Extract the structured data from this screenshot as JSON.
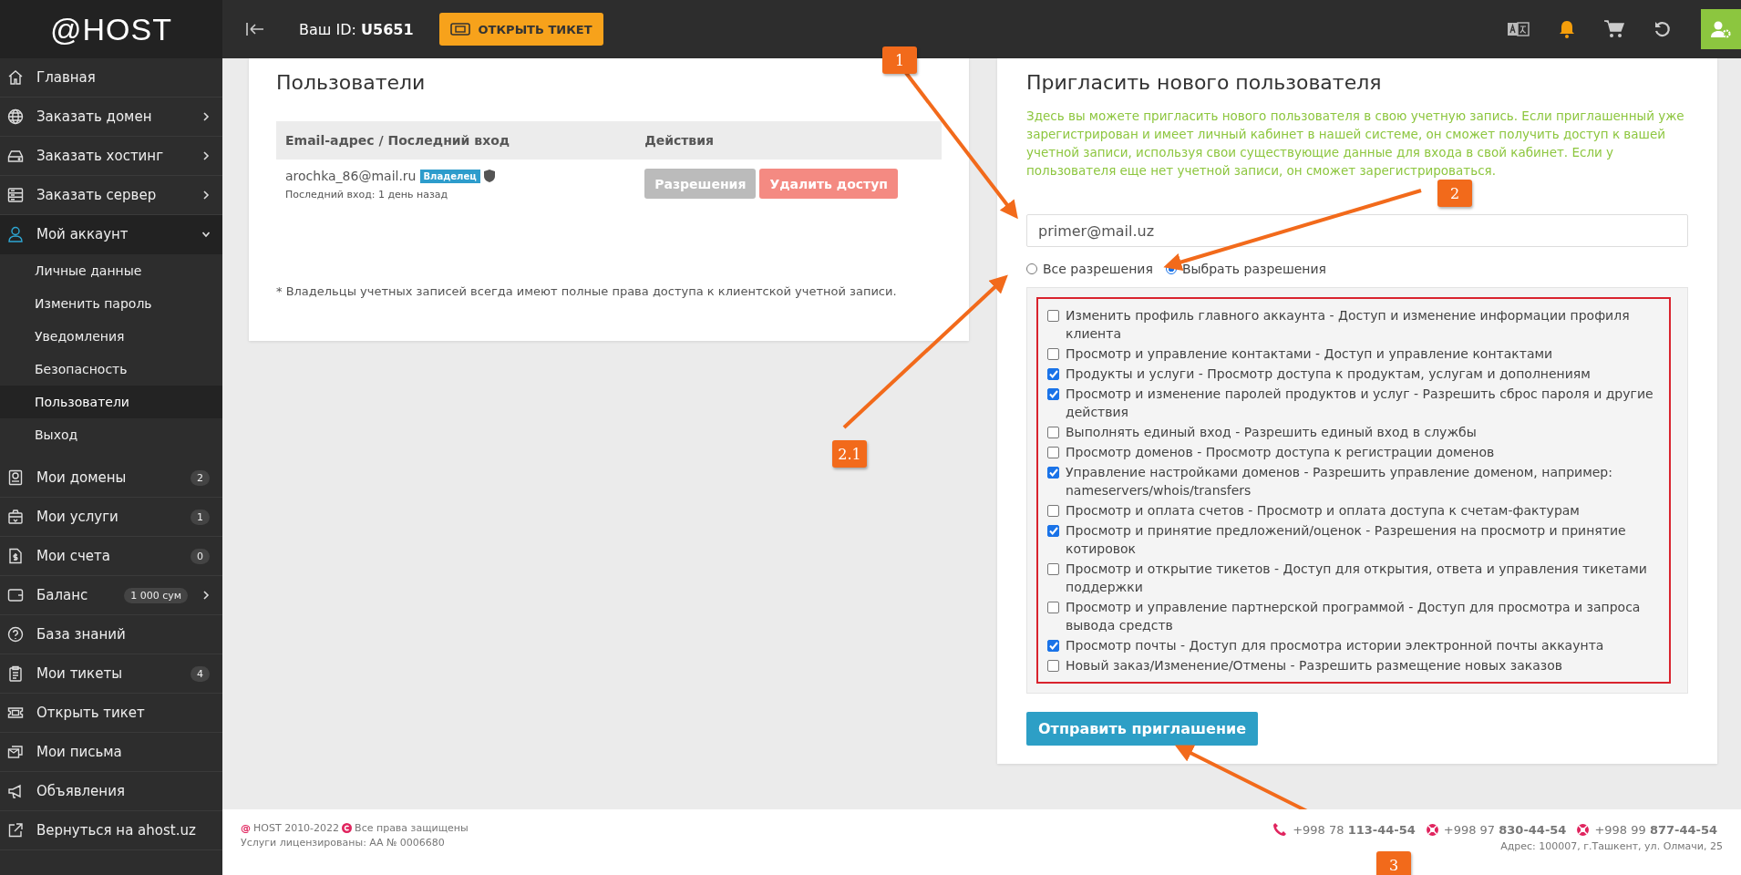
{
  "topbar": {
    "logo": "@HOST",
    "id_label": "Ваш ID:",
    "id_value": "U5651",
    "ticket_button": "ОТКРЫТЬ ТИКЕТ"
  },
  "sidebar": {
    "items": [
      {
        "label": "Главная"
      },
      {
        "label": "Заказать домен",
        "expanded": false
      },
      {
        "label": "Заказать хостинг",
        "expanded": false
      },
      {
        "label": "Заказать сервер",
        "expanded": false
      },
      {
        "label": "Мой аккаунт",
        "expanded": true,
        "children": [
          {
            "label": "Личные данные",
            "selected": false
          },
          {
            "label": "Изменить пароль",
            "selected": false
          },
          {
            "label": "Уведомления",
            "selected": false
          },
          {
            "label": "Безопасность",
            "selected": false
          },
          {
            "label": "Пользователи",
            "selected": true
          },
          {
            "label": "Выход",
            "selected": false
          }
        ]
      },
      {
        "label": "Мои домены",
        "badge": "2"
      },
      {
        "label": "Мои услуги",
        "badge": "1"
      },
      {
        "label": "Мои счета",
        "badge": "0"
      },
      {
        "label": "Баланс",
        "badge": "1 000 сум",
        "expanded": false
      },
      {
        "label": "База знаний"
      },
      {
        "label": "Мои тикеты",
        "badge": "4"
      },
      {
        "label": "Открыть тикет"
      },
      {
        "label": "Мои письма"
      },
      {
        "label": "Объявления"
      },
      {
        "label": "Вернуться на ahost.uz"
      }
    ]
  },
  "users_card": {
    "title": "Пользователи",
    "columns": [
      "Email-адрес / Последний вход",
      "Действия"
    ],
    "rows": [
      {
        "email": "arochka_86@mail.ru",
        "role": "Владелец",
        "last_login": "Последний вход: 1 день назад",
        "actions": [
          "Разрешения",
          "Удалить доступ"
        ]
      }
    ],
    "note": "* Владельцы учетных записей всегда имеют полные права доступа к клиентской учетной записи."
  },
  "invite_card": {
    "title": "Пригласить нового пользователя",
    "description": "Здесь вы можете пригласить нового пользователя в свою учетную запись. Если приглашенный уже зарегистрирован и имеет личный кабинет в нашей системе, он сможет получить доступ к вашей учетной записи, используя свои существующие данные для входа в свой кабинет. Если у пользователя еще нет учетной записи, он сможет зарегистрироваться.",
    "email_placeholder": "primer@mail.uz",
    "scope": [
      {
        "label": "Все разрешения",
        "selected": false
      },
      {
        "label": "Выбрать разрешения",
        "selected": true
      }
    ],
    "permissions": [
      {
        "label": "Изменить профиль главного аккаунта - Доступ и изменение информации профиля клиента",
        "checked": false
      },
      {
        "label": "Просмотр и управление контактами - Доступ и управление контактами",
        "checked": false
      },
      {
        "label": "Продукты и услуги - Просмотр доступа к продуктам, услугам и дополнениям",
        "checked": true
      },
      {
        "label": "Просмотр и изменение паролей продуктов и услуг - Разрешить сброс пароля и другие действия",
        "checked": true
      },
      {
        "label": "Выполнять единый вход - Разрешить единый вход в службы",
        "checked": false
      },
      {
        "label": "Просмотр доменов - Просмотр доступа к регистрации доменов",
        "checked": false
      },
      {
        "label": "Управление настройками доменов - Разрешить управление доменом, например: nameservers/whois/transfers",
        "checked": true
      },
      {
        "label": "Просмотр и оплата счетов - Просмотр и оплата доступа к счетам-фактурам",
        "checked": false
      },
      {
        "label": "Просмотр и принятие предложений/оценок - Разрешения на просмотр и принятие котировок",
        "checked": true
      },
      {
        "label": "Просмотр и открытие тикетов - Доступ для открытия, ответа и управления тикетами поддержки",
        "checked": false
      },
      {
        "label": "Просмотр и управление партнерской программой - Доступ для просмотра и запроса вывода средств",
        "checked": false
      },
      {
        "label": "Просмотр почты - Доступ для просмотра истории электронной почты аккаунта",
        "checked": true
      },
      {
        "label": "Новый заказ/Изменение/Отмены - Разрешить размещение новых заказов",
        "checked": false
      }
    ],
    "submit": "Отправить приглашение"
  },
  "footer": {
    "brand_mark": "@",
    "brand": "HOST 2010-2022",
    "rights": "Все права защищены",
    "license": "Услуги лицензированы: АА № 0006680",
    "phones": [
      "+998 78 **113-44-54**",
      "+998 97 **830-44-54**",
      "+998 99 **877-44-54**"
    ],
    "address": "Адрес: 100007, г.Ташкент, ул. Олмачи, 25"
  },
  "annotations": [
    {
      "label": "1"
    },
    {
      "label": "2"
    },
    {
      "label": "2.1"
    },
    {
      "label": "3"
    }
  ]
}
